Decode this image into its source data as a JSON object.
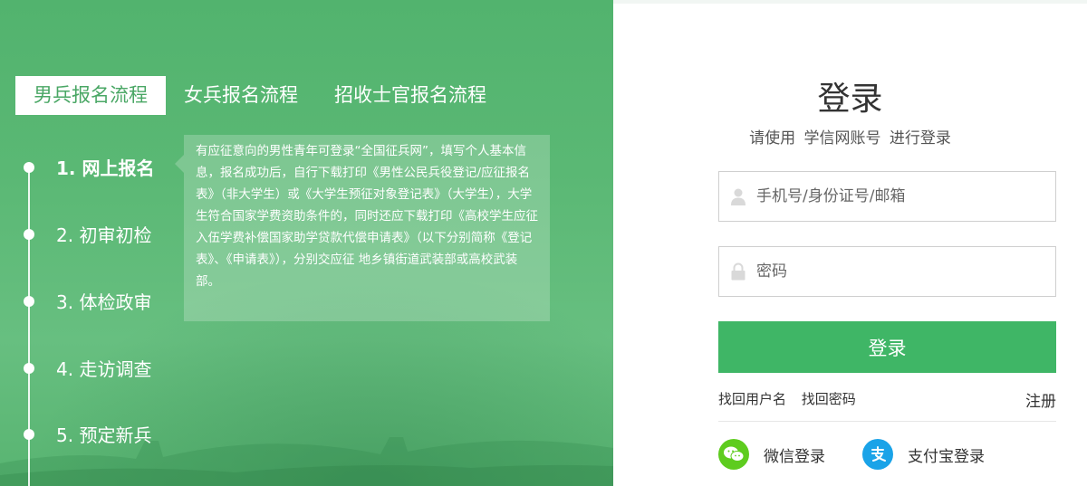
{
  "left_panel": {
    "tabs": [
      {
        "label": "男兵报名流程",
        "active": true
      },
      {
        "label": "女兵报名流程",
        "active": false
      },
      {
        "label": "招收士官报名流程",
        "active": false
      }
    ],
    "steps": [
      {
        "label": "1. 网上报名",
        "active": true
      },
      {
        "label": "2. 初审初检",
        "active": false
      },
      {
        "label": "3. 体检政审",
        "active": false
      },
      {
        "label": "4. 走访调查",
        "active": false
      },
      {
        "label": "5. 预定新兵",
        "active": false
      }
    ],
    "tooltip": "有应征意向的男性青年可登录“全国征兵网”，填写个人基本信息，报名成功后，自行下载打印《男性公民兵役登记/应征报名表》（非大学生）或《大学生预征对象登记表》（大学生），大学生符合国家学费资助条件的，同时还应下载打印《高校学生应征入伍学费补偿国家助学贷款代偿申请表》（以下分别简称《登记表》、《申请表》），分别交应征 地乡镇街道武装部或高校武装部。"
  },
  "login": {
    "title": "登录",
    "subtitle": "请使用 学信网账号 进行登录",
    "username_placeholder": "手机号/身份证号/邮箱",
    "password_placeholder": "密码",
    "submit_label": "登录",
    "forgot_username": "找回用户名",
    "forgot_password": "找回密码",
    "register": "注册",
    "wechat_label": "微信登录",
    "alipay_label": "支付宝登录"
  },
  "colors": {
    "green_bg": "#55b570",
    "button_green": "#3fb666",
    "wechat_green": "#5ecc1f",
    "alipay_blue": "#1aa3e8"
  },
  "icons": {
    "user": "user-icon",
    "lock": "lock-icon",
    "wechat": "wechat-icon",
    "alipay": "alipay-icon"
  }
}
